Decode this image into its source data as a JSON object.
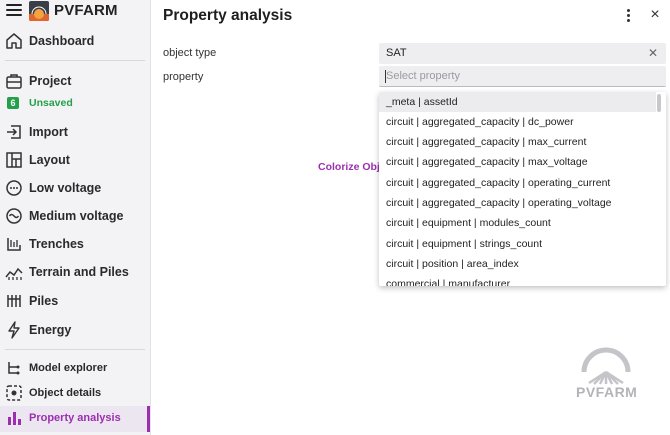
{
  "app": {
    "name": "PVFARM"
  },
  "sidebar": {
    "items": [
      {
        "label": "Dashboard"
      },
      {
        "label": "Project"
      },
      {
        "label": "Import"
      },
      {
        "label": "Layout"
      },
      {
        "label": "Low voltage"
      },
      {
        "label": "Medium voltage"
      },
      {
        "label": "Trenches"
      },
      {
        "label": "Terrain and Piles"
      },
      {
        "label": "Piles"
      },
      {
        "label": "Energy"
      }
    ],
    "project_status": {
      "badge": "6",
      "text": "Unsaved"
    },
    "tools": [
      {
        "label": "Model explorer"
      },
      {
        "label": "Object details"
      },
      {
        "label": "Property analysis"
      }
    ]
  },
  "main": {
    "title": "Property analysis",
    "fields": {
      "object_type_label": "object type",
      "object_type_value": "SAT",
      "property_label": "property",
      "property_placeholder": "Select property"
    },
    "colorize_label": "Colorize Obje",
    "dropdown_options": [
      "_meta | assetId",
      "circuit | aggregated_capacity | dc_power",
      "circuit | aggregated_capacity | max_current",
      "circuit | aggregated_capacity | max_voltage",
      "circuit | aggregated_capacity | operating_current",
      "circuit | aggregated_capacity | operating_voltage",
      "circuit | equipment | modules_count",
      "circuit | equipment | strings_count",
      "circuit | position | area_index",
      "commercial | manufacturer"
    ],
    "watermark": "PVFARM"
  },
  "colors": {
    "accent": "#9c2fb0",
    "saved_status": "#23a04a"
  }
}
